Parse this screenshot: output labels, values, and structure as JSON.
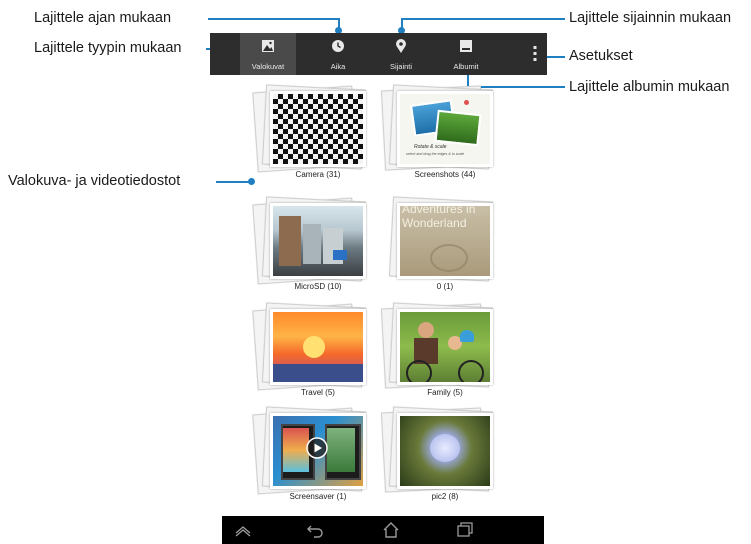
{
  "annotations": {
    "sort_time": "Lajittele ajan mukaan",
    "sort_type": "Lajittele tyypin mukaan",
    "sort_location": "Lajittele sijainnin mukaan",
    "settings": "Asetukset",
    "sort_album": "Lajittele albumin mukaan",
    "files": "Valokuva- ja videotiedostot"
  },
  "toolbar": {
    "tabs": [
      {
        "label": "Valokuvat",
        "icon": "photos-icon"
      },
      {
        "label": "Aika",
        "icon": "clock-icon"
      },
      {
        "label": "Sijainti",
        "icon": "location-pin-icon"
      },
      {
        "label": "Albumit",
        "icon": "albums-icon"
      }
    ],
    "active_tab": "Valokuvat",
    "menu_icon": "overflow-menu-icon"
  },
  "albums": [
    {
      "caption": "Camera (31)"
    },
    {
      "caption": "Screenshots (44)",
      "thumb_text_1": "Rotate & scale",
      "thumb_text_2": "select and drag the edges & to scale"
    },
    {
      "caption": "MicroSD (10)"
    },
    {
      "caption": "0 (1)",
      "thumb_text": "Adventures in Wonderland"
    },
    {
      "caption": "Travel (5)"
    },
    {
      "caption": "Family (5)"
    },
    {
      "caption": "Screensaver (1)"
    },
    {
      "caption": "pic2 (8)"
    }
  ],
  "navbar": {
    "icons": [
      "up-chevron-icon",
      "back-icon",
      "home-icon",
      "recent-apps-icon"
    ]
  },
  "colors": {
    "accent": "#1f7fc1",
    "toolbar": "#2d2d2d",
    "navbar": "#000000"
  }
}
